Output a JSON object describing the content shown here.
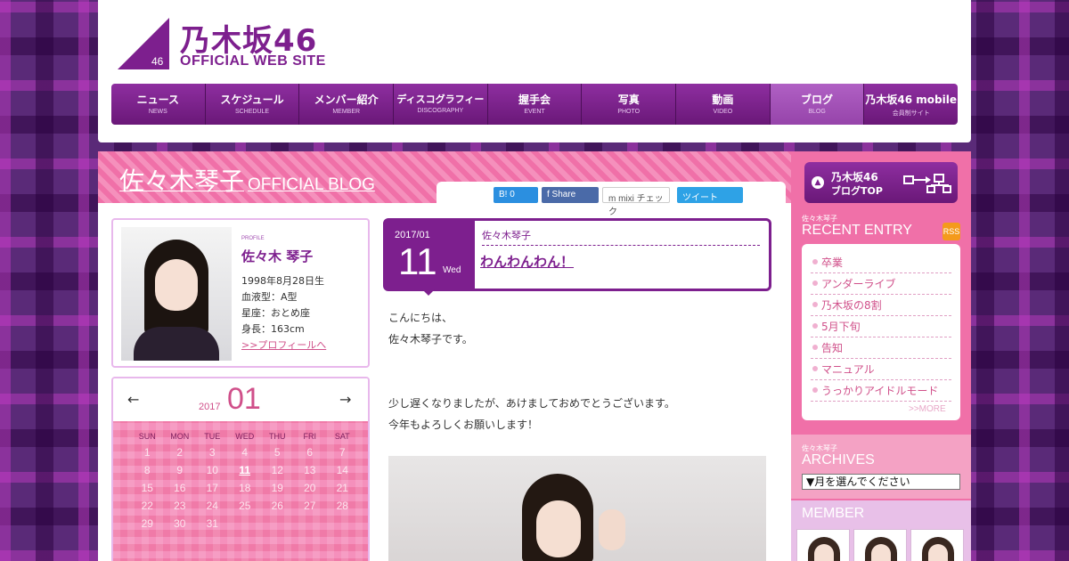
{
  "logo": {
    "number": "46",
    "japanese": "乃木坂46",
    "english": "OFFICIAL WEB SITE"
  },
  "nav": [
    {
      "jp": "ニュース",
      "en": "NEWS"
    },
    {
      "jp": "スケジュール",
      "en": "SCHEDULE"
    },
    {
      "jp": "メンバー紹介",
      "en": "MEMBER"
    },
    {
      "jp": "ディスコグラフィー",
      "en": "DISCOGRAPHY"
    },
    {
      "jp": "握手会",
      "en": "EVENT"
    },
    {
      "jp": "写真",
      "en": "PHOTO"
    },
    {
      "jp": "動画",
      "en": "VIDEO"
    },
    {
      "jp": "ブログ",
      "en": "BLOG"
    },
    {
      "jp": "乃木坂46 mobile",
      "en": "会員制サイト"
    }
  ],
  "nav_active_index": 7,
  "blog_header": {
    "name": "佐々木琴子",
    "subtitle": "OFFICIAL BLOG"
  },
  "share": {
    "hatena": "B! 0",
    "facebook": "f Share",
    "mixi": "m mixi チェック",
    "twitter": "ツイート"
  },
  "profile": {
    "label": "PROFILE",
    "name": "佐々木 琴子",
    "birthday": "1998年8月28日生",
    "blood": "血液型：A型",
    "sign": "星座：おとめ座",
    "height": "身長：163cm",
    "link": ">>プロフィールへ"
  },
  "calendar": {
    "prev": "←",
    "next": "→",
    "year": "2017",
    "month": "01",
    "weekdays": [
      "SUN",
      "MON",
      "TUE",
      "WED",
      "THU",
      "FRI",
      "SAT"
    ],
    "weeks": [
      [
        "1",
        "2",
        "3",
        "4",
        "5",
        "6",
        "7"
      ],
      [
        "8",
        "9",
        "10",
        "11",
        "12",
        "13",
        "14"
      ],
      [
        "15",
        "16",
        "17",
        "18",
        "19",
        "20",
        "21"
      ],
      [
        "22",
        "23",
        "24",
        "25",
        "26",
        "27",
        "28"
      ],
      [
        "29",
        "30",
        "31",
        "",
        "",
        "",
        ""
      ]
    ],
    "linked_day": "11"
  },
  "post": {
    "year_month": "2017/01",
    "day": "11",
    "weekday": "Wed",
    "author": "佐々木琴子",
    "title": "わんわんわん！",
    "body": [
      "こんにちは、",
      "佐々木琴子です。",
      "少し遅くなりましたが、あけましておめでとうございます。",
      "今年もよろしくお願いします！"
    ]
  },
  "sidebar": {
    "top_button": {
      "line1": "乃木坂46",
      "line2": "ブログTOP"
    },
    "recent": {
      "small": "佐々木琴子",
      "title": "RECENT ENTRY",
      "rss": "RSS",
      "entries": [
        "卒業",
        "アンダーライブ",
        "乃木坂の8割",
        "5月下旬",
        "告知",
        "マニュアル",
        "うっかりアイドルモード"
      ],
      "more": ">>MORE"
    },
    "archives": {
      "small": "佐々木琴子",
      "title": "ARCHIVES",
      "select": "▼月を選んでください"
    },
    "member": {
      "title": "MEMBER"
    }
  },
  "colors": {
    "brand_purple": "#7d1f8e",
    "pink": "#f070a8",
    "link_pink": "#d0508a"
  }
}
